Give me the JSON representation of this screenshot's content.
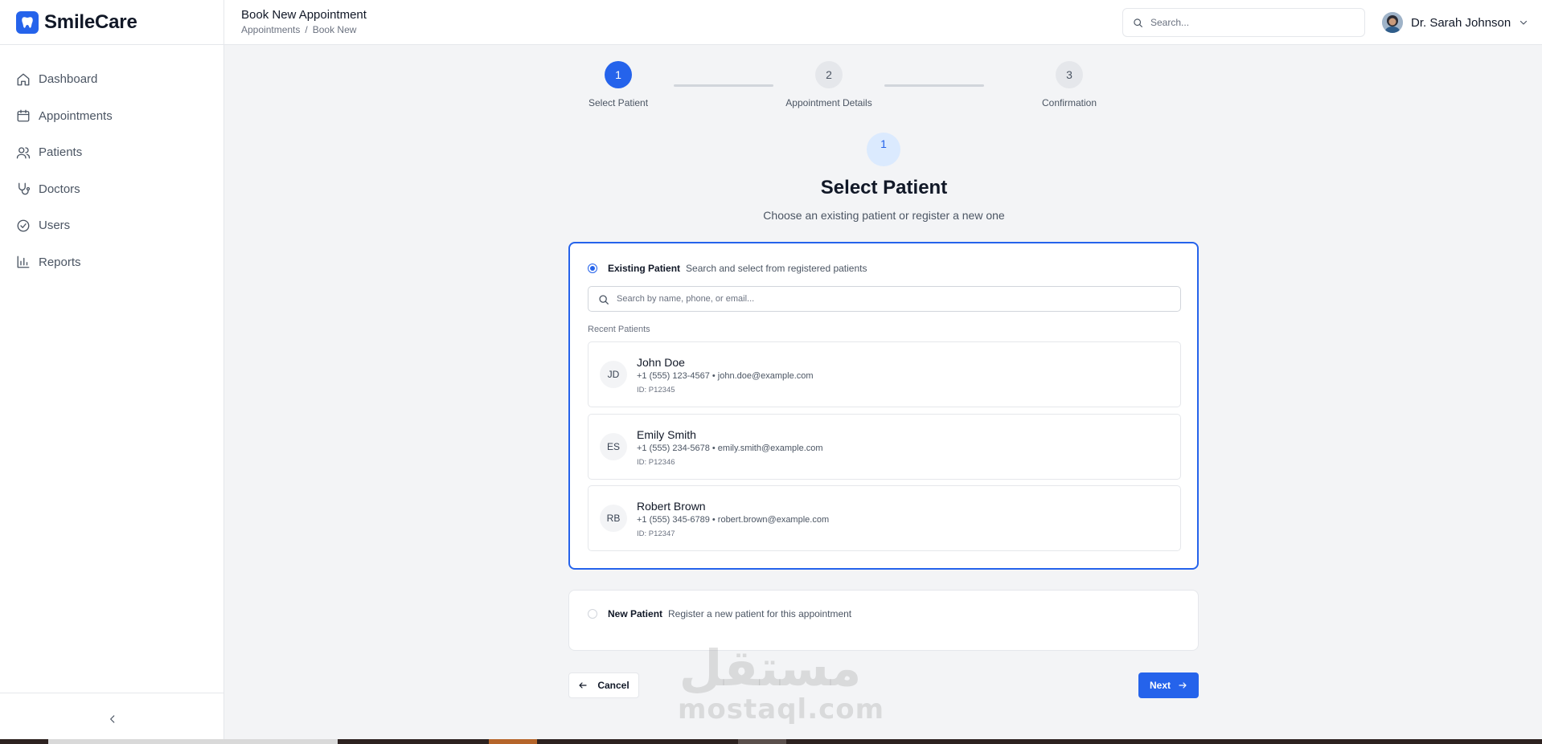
{
  "brand": {
    "name": "SmileCare",
    "logo_icon": "tooth-icon",
    "accent_color": "#2563eb"
  },
  "sidebar": {
    "items": [
      {
        "label": "Dashboard",
        "icon": "home-icon"
      },
      {
        "label": "Appointments",
        "icon": "calendar-icon"
      },
      {
        "label": "Patients",
        "icon": "users-icon"
      },
      {
        "label": "Doctors",
        "icon": "stethoscope-icon"
      },
      {
        "label": "Users",
        "icon": "check-circle-icon"
      },
      {
        "label": "Reports",
        "icon": "bar-chart-icon"
      }
    ],
    "collapse_icon": "chevron-left-icon"
  },
  "header": {
    "title": "Book New Appointment",
    "breadcrumb": [
      "Appointments",
      "Book New"
    ],
    "breadcrumb_separator": "/",
    "search_placeholder": "Search...",
    "user_name": "Dr. Sarah Johnson"
  },
  "stepper": {
    "current": 1,
    "steps": [
      {
        "number": "1",
        "label": "Select Patient"
      },
      {
        "number": "2",
        "label": "Appointment Details"
      },
      {
        "number": "3",
        "label": "Confirmation"
      }
    ]
  },
  "section": {
    "badge": "1",
    "title": "Select Patient",
    "subtitle": "Choose an existing patient or register a new one"
  },
  "existing": {
    "selected": true,
    "title": "Existing Patient",
    "description": "Search and select from registered patients",
    "search_placeholder": "Search by name, phone, or email...",
    "recent_label": "Recent Patients",
    "patients": [
      {
        "initials": "JD",
        "name": "John Doe",
        "contact": "+1 (555) 123-4567 • john.doe@example.com",
        "id": "ID: P12345"
      },
      {
        "initials": "ES",
        "name": "Emily Smith",
        "contact": "+1 (555) 234-5678 • emily.smith@example.com",
        "id": "ID: P12346"
      },
      {
        "initials": "RB",
        "name": "Robert Brown",
        "contact": "+1 (555) 345-6789 • robert.brown@example.com",
        "id": "ID: P12347"
      }
    ]
  },
  "new_patient": {
    "selected": false,
    "title": "New Patient",
    "description": "Register a new patient for this appointment"
  },
  "actions": {
    "cancel_label": "Cancel",
    "next_label": "Next"
  },
  "watermark": {
    "arabic": "مستقل",
    "latin": "mostaql.com"
  }
}
